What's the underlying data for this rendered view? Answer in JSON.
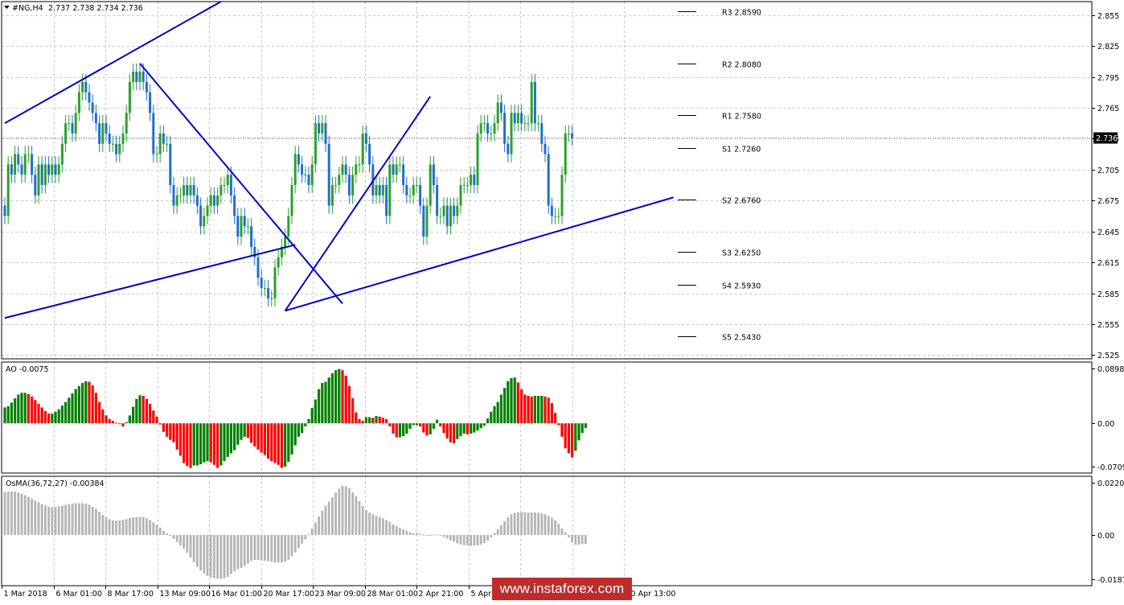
{
  "header": {
    "symbol_label": "#NG,H4",
    "ohlc": "2.737 2.738 2.734 2.736"
  },
  "price_tag": "2.736",
  "watermark": "www.instaforex.com",
  "colors": {
    "trendline": "#0000c8",
    "bull": "#2ca02c",
    "bear": "#2070c8",
    "ao_up": "#008000",
    "ao_down": "#ff0000",
    "osma": "#b4b4b4",
    "grid": "#c8c8c8",
    "tag_bg": "#000000"
  },
  "chart_data": [
    {
      "type": "candlestick",
      "title": "#NG,H4 2.737 2.738 2.734 2.736",
      "ylim": [
        2.52,
        2.87
      ],
      "yticks": [
        "2.855",
        "2.825",
        "2.795",
        "2.765",
        "2.735",
        "2.705",
        "2.675",
        "2.645",
        "2.615",
        "2.585",
        "2.555",
        "2.525"
      ],
      "last_price": 2.736,
      "x_labels": [
        "1 Mar 2018",
        "6 Mar 01:00",
        "8 Mar 17:00",
        "13 Mar 09:00",
        "16 Mar 01:00",
        "20 Mar 17:00",
        "23 Mar 09:00",
        "28 Mar 01:00",
        "2 Apr 21:00",
        "5 Apr 21:00",
        "",
        "",
        "20 Apr 13:00"
      ],
      "close": [
        2.66,
        2.71,
        2.7,
        2.72,
        2.71,
        2.7,
        2.72,
        2.72,
        2.7,
        2.68,
        2.71,
        2.69,
        2.71,
        2.7,
        2.71,
        2.7,
        2.71,
        2.73,
        2.75,
        2.75,
        2.74,
        2.76,
        2.78,
        2.79,
        2.78,
        2.77,
        2.76,
        2.75,
        2.73,
        2.75,
        2.74,
        2.73,
        2.73,
        2.72,
        2.73,
        2.74,
        2.76,
        2.79,
        2.8,
        2.79,
        2.8,
        2.79,
        2.78,
        2.76,
        2.72,
        2.72,
        2.74,
        2.73,
        2.73,
        2.69,
        2.67,
        2.68,
        2.68,
        2.69,
        2.68,
        2.69,
        2.68,
        2.67,
        2.65,
        2.66,
        2.67,
        2.68,
        2.67,
        2.68,
        2.69,
        2.69,
        2.7,
        2.68,
        2.66,
        2.64,
        2.66,
        2.65,
        2.65,
        2.63,
        2.62,
        2.6,
        2.59,
        2.59,
        2.58,
        2.58,
        2.61,
        2.62,
        2.63,
        2.64,
        2.66,
        2.69,
        2.72,
        2.71,
        2.7,
        2.7,
        2.69,
        2.71,
        2.75,
        2.74,
        2.75,
        2.73,
        2.67,
        2.69,
        2.69,
        2.7,
        2.71,
        2.7,
        2.68,
        2.7,
        2.71,
        2.71,
        2.74,
        2.73,
        2.71,
        2.68,
        2.69,
        2.68,
        2.69,
        2.66,
        2.71,
        2.7,
        2.71,
        2.71,
        2.69,
        2.68,
        2.68,
        2.69,
        2.69,
        2.67,
        2.64,
        2.67,
        2.71,
        2.69,
        2.66,
        2.66,
        2.67,
        2.65,
        2.67,
        2.66,
        2.67,
        2.69,
        2.69,
        2.69,
        2.7,
        2.69,
        2.74,
        2.75,
        2.75,
        2.74,
        2.74,
        2.75,
        2.77,
        2.76,
        2.73,
        2.72,
        2.76,
        2.75,
        2.76,
        2.75,
        2.75,
        2.75,
        2.79,
        2.75,
        2.75,
        2.73,
        2.72,
        2.67,
        2.66,
        2.66,
        2.66,
        2.7,
        2.74,
        2.74,
        2.736
      ]
    },
    {
      "type": "bar",
      "title": "AO -0.0075",
      "ylim": [
        -0.0709,
        0.0898
      ],
      "yticks": [
        "0.0898",
        "0.00",
        "-0.0709"
      ],
      "values": [
        0.026,
        0.028,
        0.034,
        0.041,
        0.047,
        0.05,
        0.05,
        0.048,
        0.044,
        0.038,
        0.032,
        0.026,
        0.02,
        0.016,
        0.016,
        0.019,
        0.023,
        0.029,
        0.035,
        0.042,
        0.049,
        0.056,
        0.061,
        0.066,
        0.069,
        0.068,
        0.062,
        0.05,
        0.035,
        0.023,
        0.013,
        0.007,
        0.004,
        0.001,
        -0.001,
        -0.005,
        0.002,
        0.013,
        0.027,
        0.04,
        0.046,
        0.045,
        0.04,
        0.032,
        0.021,
        0.011,
        -0.002,
        -0.014,
        -0.022,
        -0.027,
        -0.031,
        -0.043,
        -0.053,
        -0.065,
        -0.07,
        -0.073,
        -0.069,
        -0.069,
        -0.067,
        -0.064,
        -0.062,
        -0.064,
        -0.068,
        -0.073,
        -0.069,
        -0.062,
        -0.055,
        -0.049,
        -0.044,
        -0.035,
        -0.027,
        -0.022,
        -0.024,
        -0.032,
        -0.038,
        -0.043,
        -0.048,
        -0.052,
        -0.058,
        -0.062,
        -0.065,
        -0.068,
        -0.073,
        -0.071,
        -0.063,
        -0.051,
        -0.036,
        -0.022,
        -0.016,
        -0.005,
        0.007,
        0.025,
        0.039,
        0.056,
        0.066,
        0.068,
        0.075,
        0.082,
        0.087,
        0.089,
        0.087,
        0.078,
        0.061,
        0.041,
        0.018,
        0.007,
        0.004,
        0.01,
        0.01,
        0.009,
        0.012,
        0.011,
        0.009,
        0.007,
        -0.005,
        -0.017,
        -0.023,
        -0.023,
        -0.021,
        -0.017,
        -0.009,
        -0.003,
        -0.003,
        -0.005,
        -0.015,
        -0.02,
        -0.018,
        -0.009,
        0.006,
        -0.005,
        -0.016,
        -0.025,
        -0.031,
        -0.033,
        -0.026,
        -0.021,
        -0.017,
        -0.018,
        -0.017,
        -0.015,
        -0.012,
        -0.008,
        -0.004,
        0.008,
        0.019,
        0.028,
        0.035,
        0.047,
        0.058,
        0.069,
        0.074,
        0.075,
        0.067,
        0.056,
        0.047,
        0.045,
        0.044,
        0.045,
        0.045,
        0.045,
        0.044,
        0.042,
        0.033,
        0.017,
        -0.003,
        -0.022,
        -0.041,
        -0.049,
        -0.056,
        -0.045,
        -0.028,
        -0.016,
        -0.0075
      ]
    },
    {
      "type": "bar",
      "title": "OsMA(36,72,27) -0.00384",
      "ylim": [
        -0.01874,
        0.02208
      ],
      "yticks": [
        "0.02208",
        "0.00",
        "-0.01874"
      ],
      "values": [
        0.0182,
        0.0184,
        0.0184,
        0.0183,
        0.018,
        0.0174,
        0.0168,
        0.0161,
        0.0154,
        0.0146,
        0.0139,
        0.0131,
        0.0124,
        0.0119,
        0.0117,
        0.0118,
        0.0121,
        0.0124,
        0.0127,
        0.013,
        0.0132,
        0.0134,
        0.0134,
        0.0134,
        0.0132,
        0.0127,
        0.0119,
        0.011,
        0.0098,
        0.0085,
        0.0074,
        0.0066,
        0.0062,
        0.0061,
        0.0061,
        0.0063,
        0.0067,
        0.0072,
        0.0074,
        0.0075,
        0.0076,
        0.0076,
        0.0071,
        0.0063,
        0.0053,
        0.0043,
        0.0031,
        0.0018,
        0.0007,
        -0.0004,
        -0.0016,
        -0.003,
        -0.0044,
        -0.0058,
        -0.0075,
        -0.0095,
        -0.0115,
        -0.0134,
        -0.015,
        -0.0163,
        -0.0173,
        -0.018,
        -0.0183,
        -0.0185,
        -0.0186,
        -0.0183,
        -0.0177,
        -0.0165,
        -0.0154,
        -0.0145,
        -0.0139,
        -0.0131,
        -0.0121,
        -0.011,
        -0.0106,
        -0.0105,
        -0.0107,
        -0.0109,
        -0.0111,
        -0.0114,
        -0.0117,
        -0.0117,
        -0.0116,
        -0.0113,
        -0.0105,
        -0.009,
        -0.0074,
        -0.0055,
        -0.0037,
        -0.0018,
        0.0004,
        0.0027,
        0.0053,
        0.0078,
        0.0102,
        0.0124,
        0.0141,
        0.0159,
        0.0179,
        0.0196,
        0.0207,
        0.0206,
        0.0198,
        0.018,
        0.0163,
        0.0143,
        0.0122,
        0.0105,
        0.0094,
        0.0087,
        0.0081,
        0.0075,
        0.007,
        0.0062,
        0.0054,
        0.0045,
        0.0037,
        0.003,
        0.0023,
        0.0018,
        0.0012,
        0.0008,
        0.0008,
        0.0005,
        0.0001,
        -0.0001,
        0.0,
        0.0002,
        0.0002,
        -0.0003,
        -0.0009,
        -0.0015,
        -0.0022,
        -0.0028,
        -0.0035,
        -0.004,
        -0.0043,
        -0.0044,
        -0.0046,
        -0.0045,
        -0.0044,
        -0.0041,
        -0.0035,
        -0.0025,
        -0.0011,
        0.0008,
        0.0024,
        0.0041,
        0.0058,
        0.0075,
        0.0087,
        0.0093,
        0.0096,
        0.0096,
        0.0096,
        0.0095,
        0.0095,
        0.0095,
        0.0094,
        0.0091,
        0.0087,
        0.008,
        0.0073,
        0.0062,
        0.0047,
        0.0028,
        0.0011,
        -0.001,
        -0.0031,
        -0.0042,
        -0.0042,
        -0.0037,
        -0.0038
      ]
    }
  ],
  "levels": [
    {
      "label": "R3 2.8590",
      "value": 2.859
    },
    {
      "label": "R2 2.8080",
      "value": 2.808
    },
    {
      "label": "R1 2.7580",
      "value": 2.758
    },
    {
      "label": "S1 2.7260",
      "value": 2.726
    },
    {
      "label": "S2 2.6760",
      "value": 2.676
    },
    {
      "label": "S3 2.6250",
      "value": 2.625
    },
    {
      "label": "S4 2.5930",
      "value": 2.593
    },
    {
      "label": "S5 2.5430",
      "value": 2.543
    }
  ],
  "trendlines": [
    {
      "from": [
        0,
        2.75
      ],
      "to": [
        64,
        2.868
      ]
    },
    {
      "from": [
        40,
        2.808
      ],
      "to": [
        100,
        2.575
      ]
    },
    {
      "from": [
        0,
        2.561
      ],
      "to": [
        86,
        2.632
      ]
    },
    {
      "from": [
        83,
        2.568
      ],
      "to": [
        126,
        2.776
      ]
    },
    {
      "from": [
        83,
        2.568
      ],
      "to": [
        198,
        2.678
      ]
    }
  ]
}
